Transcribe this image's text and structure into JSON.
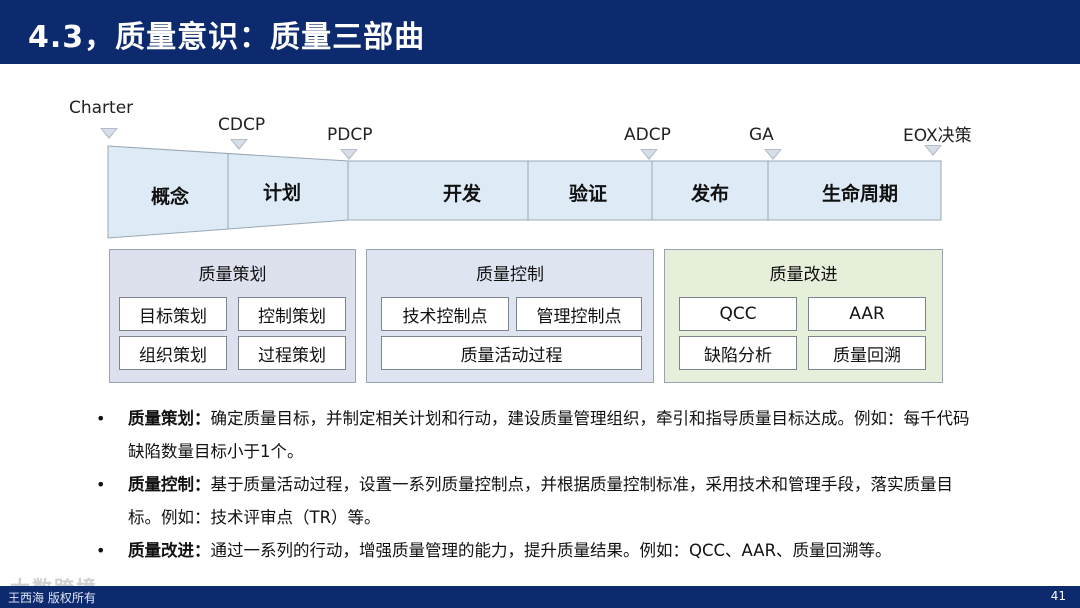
{
  "header": {
    "title": "4.3，质量意识：质量三部曲"
  },
  "milestones": [
    "Charter",
    "CDCP",
    "PDCP",
    "ADCP",
    "GA",
    "EOX决策"
  ],
  "phases": [
    "概念",
    "计划",
    "开发",
    "验证",
    "发布",
    "生命周期"
  ],
  "colors": {
    "band_fill": "#deebf7",
    "band_stroke": "#9aa7b5",
    "title_bar": "#0d2a6e",
    "planning_bg": "#dde1ee",
    "control_bg": "#dee5f1",
    "improve_bg": "#e6efda"
  },
  "panels": {
    "planning": {
      "title": "质量策划",
      "items": [
        "目标策划",
        "控制策划",
        "组织策划",
        "过程策划"
      ]
    },
    "control": {
      "title": "质量控制",
      "items": [
        "技术控制点",
        "管理控制点",
        "质量活动过程"
      ]
    },
    "improvement": {
      "title": "质量改进",
      "items": [
        "QCC",
        "AAR",
        "缺陷分析",
        "质量回溯"
      ]
    }
  },
  "bullets": [
    {
      "head": "质量策划：",
      "text": "确定质量目标，并制定相关计划和行动，建设质量管理组织，牵引和指导质量目标达成。例如：每千代码缺陷数量目标小于1个。"
    },
    {
      "head": "质量控制：",
      "text": "基于质量活动过程，设置一系列质量控制点，并根据质量控制标准，采用技术和管理手段，落实质量目标。例如：技术评审点（TR）等。"
    },
    {
      "head": "质量改进：",
      "text": "通过一系列的行动，增强质量管理的能力，提升质量结果。例如：QCC、AAR、质量回溯等。"
    }
  ],
  "footer": {
    "copyright": "王西海 版权所有",
    "page": "41",
    "watermark": "大数跨境"
  }
}
